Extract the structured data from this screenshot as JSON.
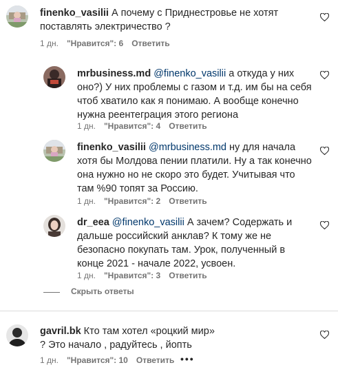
{
  "comments": [
    {
      "username": "finenko_vasilii",
      "mention": "",
      "text": "А почему с Приднестровье не хотят поставлять электричество ?",
      "time": "1 дн.",
      "likes": "\"Нравится\": 6",
      "reply": "Ответить",
      "avatar_color": "#c7b9a3"
    },
    {
      "username": "mrbusiness.md",
      "mention": "@finenko_vasilii",
      "text": "а откуда у них оно?) У них проблемы с газом и т.д. им бы на себя чтоб хватило как я понимаю. А вообще конечно нужна реентеграция этого региона",
      "time": "1 дн.",
      "likes": "\"Нравится\": 4",
      "reply": "Ответить",
      "avatar_color": "#5a3a35"
    },
    {
      "username": "finenko_vasilii",
      "mention": "@mrbusiness.md",
      "text": "ну для начала хотя бы Молдова пении платили. Ну а так конечно она нужно но не скоро это будет. Учитывая что там %90 топят за Россию.",
      "time": "1 дн.",
      "likes": "\"Нравится\": 2",
      "reply": "Ответить",
      "avatar_color": "#c7b9a3"
    },
    {
      "username": "dr_eea",
      "mention": "@finenko_vasilii",
      "text": "А зачем? Содержать и дальше российский анклав? К тому же не безопасно покупать там. Урок, полученный в конце 2021 - начале 2022, усвоен.",
      "time": "1 дн.",
      "likes": "\"Нравится\": 3",
      "reply": "Ответить",
      "avatar_color": "#d9d4cf"
    },
    {
      "username": "gavril.bk",
      "mention": "",
      "text": "Кто там хотел «роцкий мир» ? Это начало , радуйтесь , йопть",
      "time": "1 дн.",
      "likes": "\"Нравится\": 10",
      "reply": "Ответить",
      "avatar_color": "#555555"
    }
  ],
  "hide_replies_label": "Скрыть ответы",
  "more_options": "•••"
}
